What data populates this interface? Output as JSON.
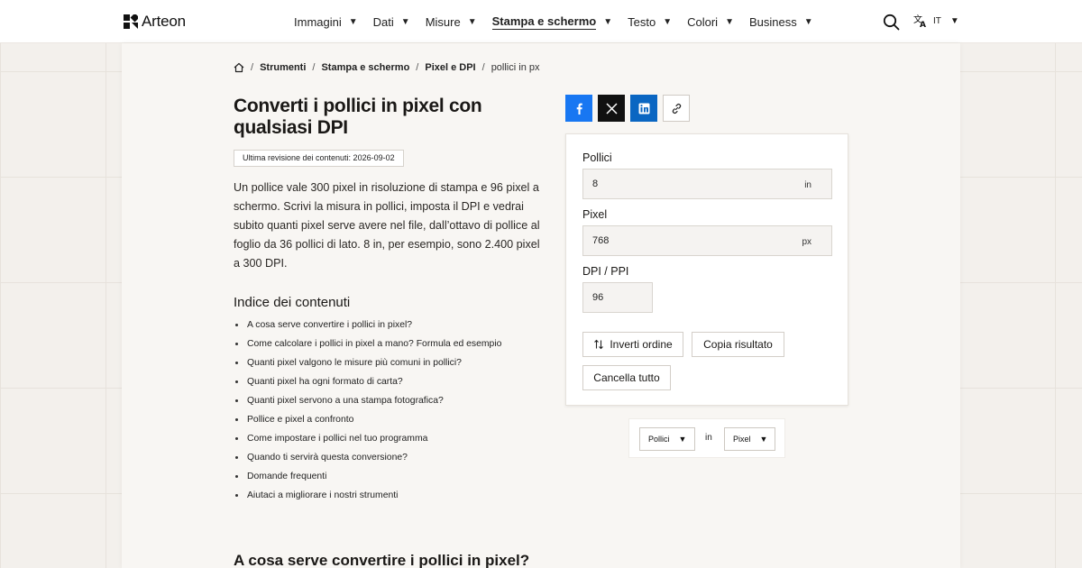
{
  "header": {
    "logo_text": "Arteon",
    "nav": [
      {
        "label": "Immagini",
        "active": false
      },
      {
        "label": "Dati",
        "active": false
      },
      {
        "label": "Misure",
        "active": false
      },
      {
        "label": "Stampa e schermo",
        "active": true
      },
      {
        "label": "Testo",
        "active": false
      },
      {
        "label": "Colori",
        "active": false
      },
      {
        "label": "Business",
        "active": false
      }
    ],
    "lang_label": "IT",
    "icons": {
      "search": "search-icon",
      "language": "translate-icon",
      "caret": "▼"
    }
  },
  "breadcrumb": {
    "items": [
      "Strumenti",
      "Stampa e schermo",
      "Pixel e DPI"
    ],
    "current": "pollici in px",
    "separator": "/"
  },
  "page": {
    "title": "Converti i pollici in pixel con qualsiasi DPI",
    "revision": "Ultima revisione dei contenuti: 2026-09-02",
    "intro": "Un pollice vale 300 pixel in risoluzione di stampa e 96 pixel a schermo. Scrivi la misura in pollici, imposta il DPI e vedrai subito quanti pixel serve avere nel file, dall’ottavo di pollice al foglio da 36 pollici di lato. 8 in, per esempio, sono 2.400 pixel a 300 DPI.",
    "toc_title": "Indice dei contenuti",
    "toc": [
      "A cosa serve convertire i pollici in pixel?",
      "Come calcolare i pollici in pixel a mano? Formula ed esempio",
      "Quanti pixel valgono le misure più comuni in pollici?",
      "Quanti pixel ha ogni formato di carta?",
      "Quanti pixel servono a una stampa fotografica?",
      "Pollice e pixel a confronto",
      "Come impostare i pollici nel tuo programma",
      "Quando ti servirà questa conversione?",
      "Domande frequenti",
      "Aiutaci a migliorare i nostri strumenti"
    ],
    "section_title": "A cosa serve convertire i pollici in pixel?"
  },
  "share": {
    "icons": [
      "facebook-icon",
      "x-icon",
      "linkedin-icon",
      "link-icon"
    ],
    "colors": {
      "facebook": "#1877f2",
      "x": "#111111",
      "linkedin": "#0a66c2"
    }
  },
  "converter": {
    "inches_label": "Pollici",
    "inches_value": "8",
    "inches_unit": "in",
    "pixels_label": "Pixel",
    "pixels_value": "768",
    "pixels_unit": "px",
    "dpi_label": "DPI / PPI",
    "dpi_value": "96",
    "swap_label": "Inverti ordine",
    "copy_label": "Copia risultato",
    "clear_label": "Cancella tutto"
  },
  "unit_selector": {
    "from": "Pollici",
    "separator": "in",
    "to": "Pixel"
  }
}
